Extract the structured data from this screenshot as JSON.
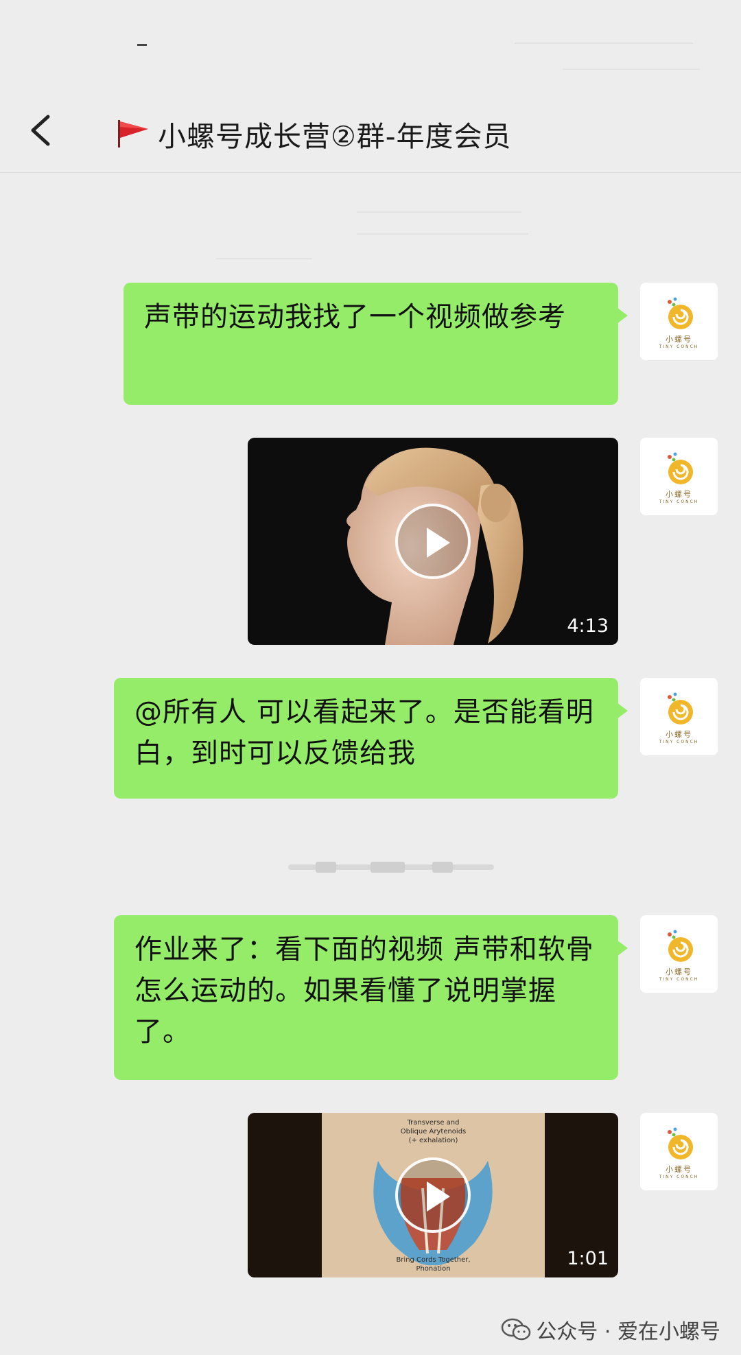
{
  "header": {
    "title": "小螺号成长营②群-年度会员",
    "back_icon": "chevron-left-icon",
    "flag_icon": "red-flag-icon"
  },
  "avatar": {
    "brand_text": "小螺号",
    "brand_sub": "TINY CONCH"
  },
  "messages": [
    {
      "type": "text",
      "text": "声带的运动我找了一个视频做参考"
    },
    {
      "type": "video",
      "duration": "4:13"
    },
    {
      "type": "text",
      "text": "@所有人 可以看起来了。是否能看明白，到时可以反馈给我"
    },
    {
      "type": "text",
      "text": "作业来了：看下面的视频 声带和软骨怎么运动的。如果看懂了说明掌握了。"
    },
    {
      "type": "video",
      "duration": "1:01",
      "top_caption_1": "Transverse and",
      "top_caption_2": "Oblique Arytenoids",
      "top_caption_3": "(+ exhalation)",
      "bottom_caption_1": "Bring Cords Together,",
      "bottom_caption_2": "Phonation"
    }
  ],
  "watermark": {
    "text": "公众号 · 爱在小螺号"
  },
  "colors": {
    "bubble": "#95ec69",
    "background": "#ededed"
  }
}
